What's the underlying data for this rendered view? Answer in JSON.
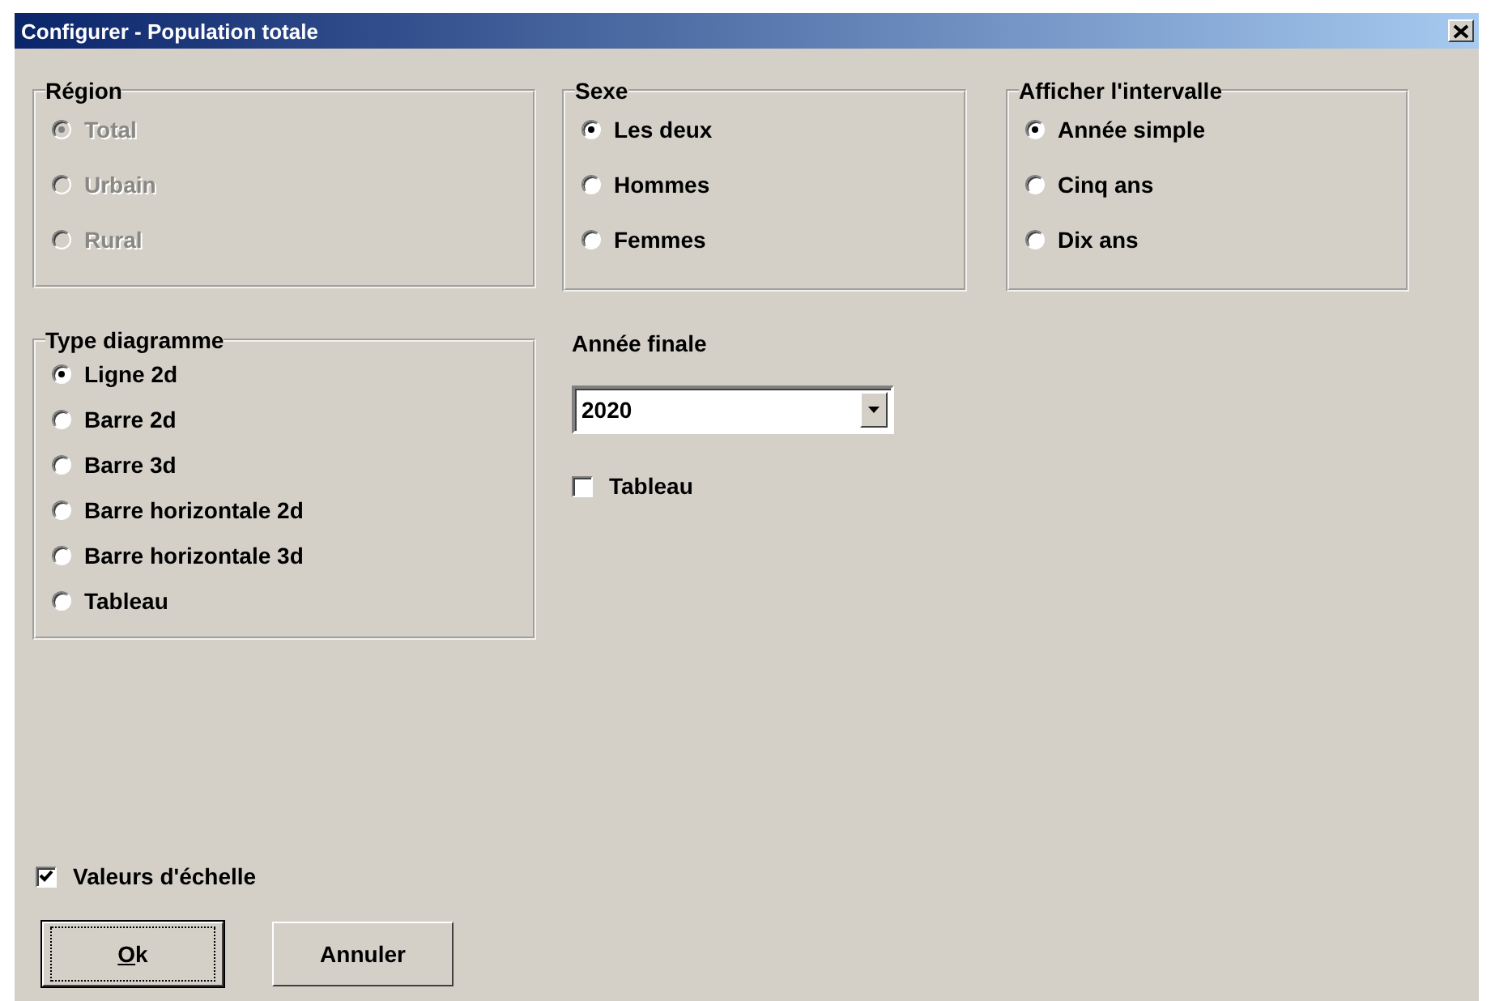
{
  "window": {
    "title": "Configurer - Population totale"
  },
  "top_groups": [
    {
      "title": "Région",
      "disabled": true,
      "options": [
        {
          "label": "Total",
          "selected": true
        },
        {
          "label": "Urbain",
          "selected": false
        },
        {
          "label": "Rural",
          "selected": false
        }
      ]
    },
    {
      "title": "Sexe",
      "disabled": false,
      "options": [
        {
          "label": "Les deux",
          "selected": true
        },
        {
          "label": "Hommes",
          "selected": false
        },
        {
          "label": "Femmes",
          "selected": false
        }
      ]
    },
    {
      "title": "Afficher l'intervalle",
      "disabled": false,
      "options": [
        {
          "label": "Année simple",
          "selected": true
        },
        {
          "label": "Cinq ans",
          "selected": false
        },
        {
          "label": "Dix ans",
          "selected": false
        }
      ]
    }
  ],
  "diagram_type": {
    "title": "Type diagramme",
    "disabled": false,
    "options": [
      {
        "label": "Ligne 2d",
        "selected": true
      },
      {
        "label": "Barre 2d",
        "selected": false
      },
      {
        "label": "Barre 3d",
        "selected": false
      },
      {
        "label": "Barre horizontale 2d",
        "selected": false
      },
      {
        "label": "Barre horizontale 3d",
        "selected": false
      },
      {
        "label": "Tableau",
        "selected": false
      }
    ]
  },
  "end_year": {
    "label": "Année finale",
    "value": "2020"
  },
  "table_checkbox": {
    "label": "Tableau",
    "checked": false
  },
  "scale_values": {
    "label": "Valeurs d'échelle",
    "checked": true
  },
  "buttons": [
    {
      "label": "Ok",
      "default": true
    },
    {
      "label": "Annuler",
      "default": false
    }
  ]
}
